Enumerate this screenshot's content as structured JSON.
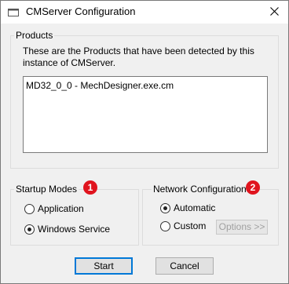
{
  "window": {
    "title": "CMServer Configuration"
  },
  "products": {
    "group_label": "Products",
    "description": "These are the Products that have been detected by this instance of CMServer.",
    "items": [
      "MD32_0_0 - MechDesigner.exe.cm"
    ]
  },
  "startup": {
    "group_label": "Startup Modes",
    "badge": "1",
    "options": [
      {
        "label": "Application",
        "checked": false
      },
      {
        "label": "Windows Service",
        "checked": true
      }
    ]
  },
  "network": {
    "group_label": "Network Configuration",
    "badge": "2",
    "options": [
      {
        "label": "Automatic",
        "checked": true
      },
      {
        "label": "Custom",
        "checked": false
      }
    ],
    "options_button": "Options >>"
  },
  "buttons": {
    "start": "Start",
    "cancel": "Cancel"
  },
  "colors": {
    "badge": "#e0141e",
    "default_button_border": "#0078d7"
  }
}
